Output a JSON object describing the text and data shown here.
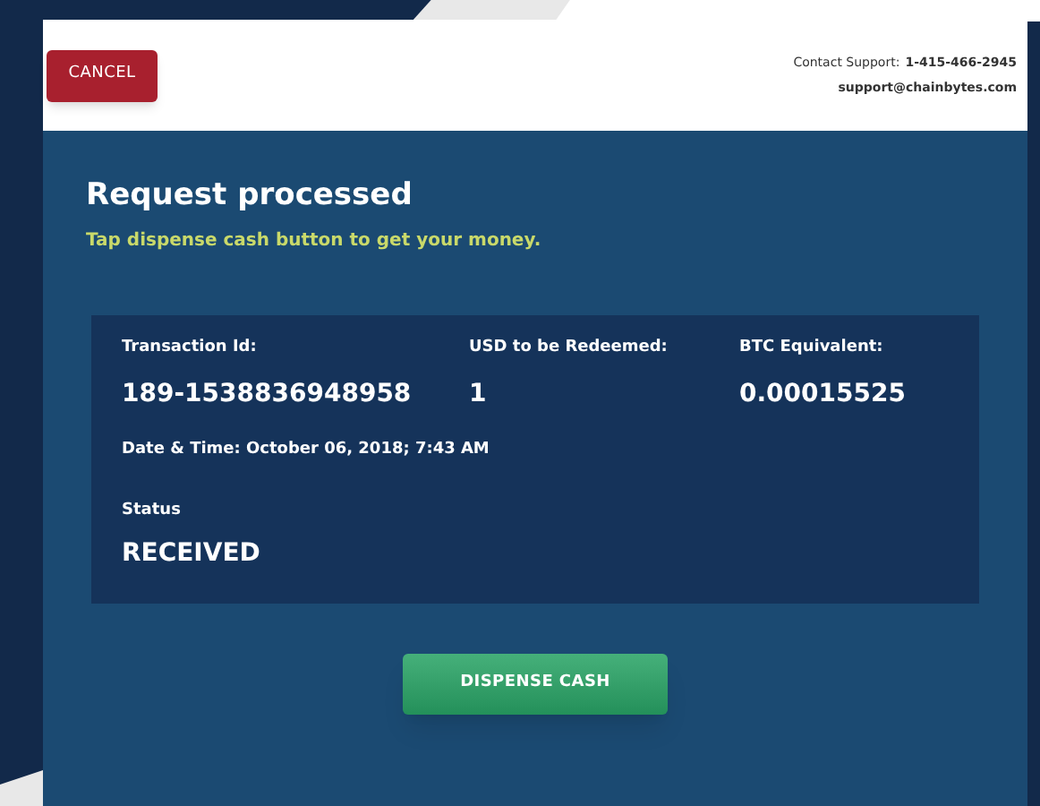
{
  "header": {
    "cancel_button": "CANCEL",
    "support_label": "Contact Support:",
    "support_phone": "1-415-466-2945",
    "support_email": "support@chainbytes.com"
  },
  "title": "Request processed",
  "subtitle": "Tap dispense cash button to get your money.",
  "details": {
    "fields": [
      {
        "label": "Transaction Id:",
        "value": "189-1538836948958"
      },
      {
        "label": "USD to be Redeemed:",
        "value": "1"
      },
      {
        "label": "BTC Equivalent:",
        "value": "0.00015525"
      }
    ],
    "date_time": "Date & Time: October 06, 2018; 7:43 AM",
    "status_label": "Status",
    "status_value": "RECEIVED"
  },
  "primary_button": "DISPENSE CASH"
}
